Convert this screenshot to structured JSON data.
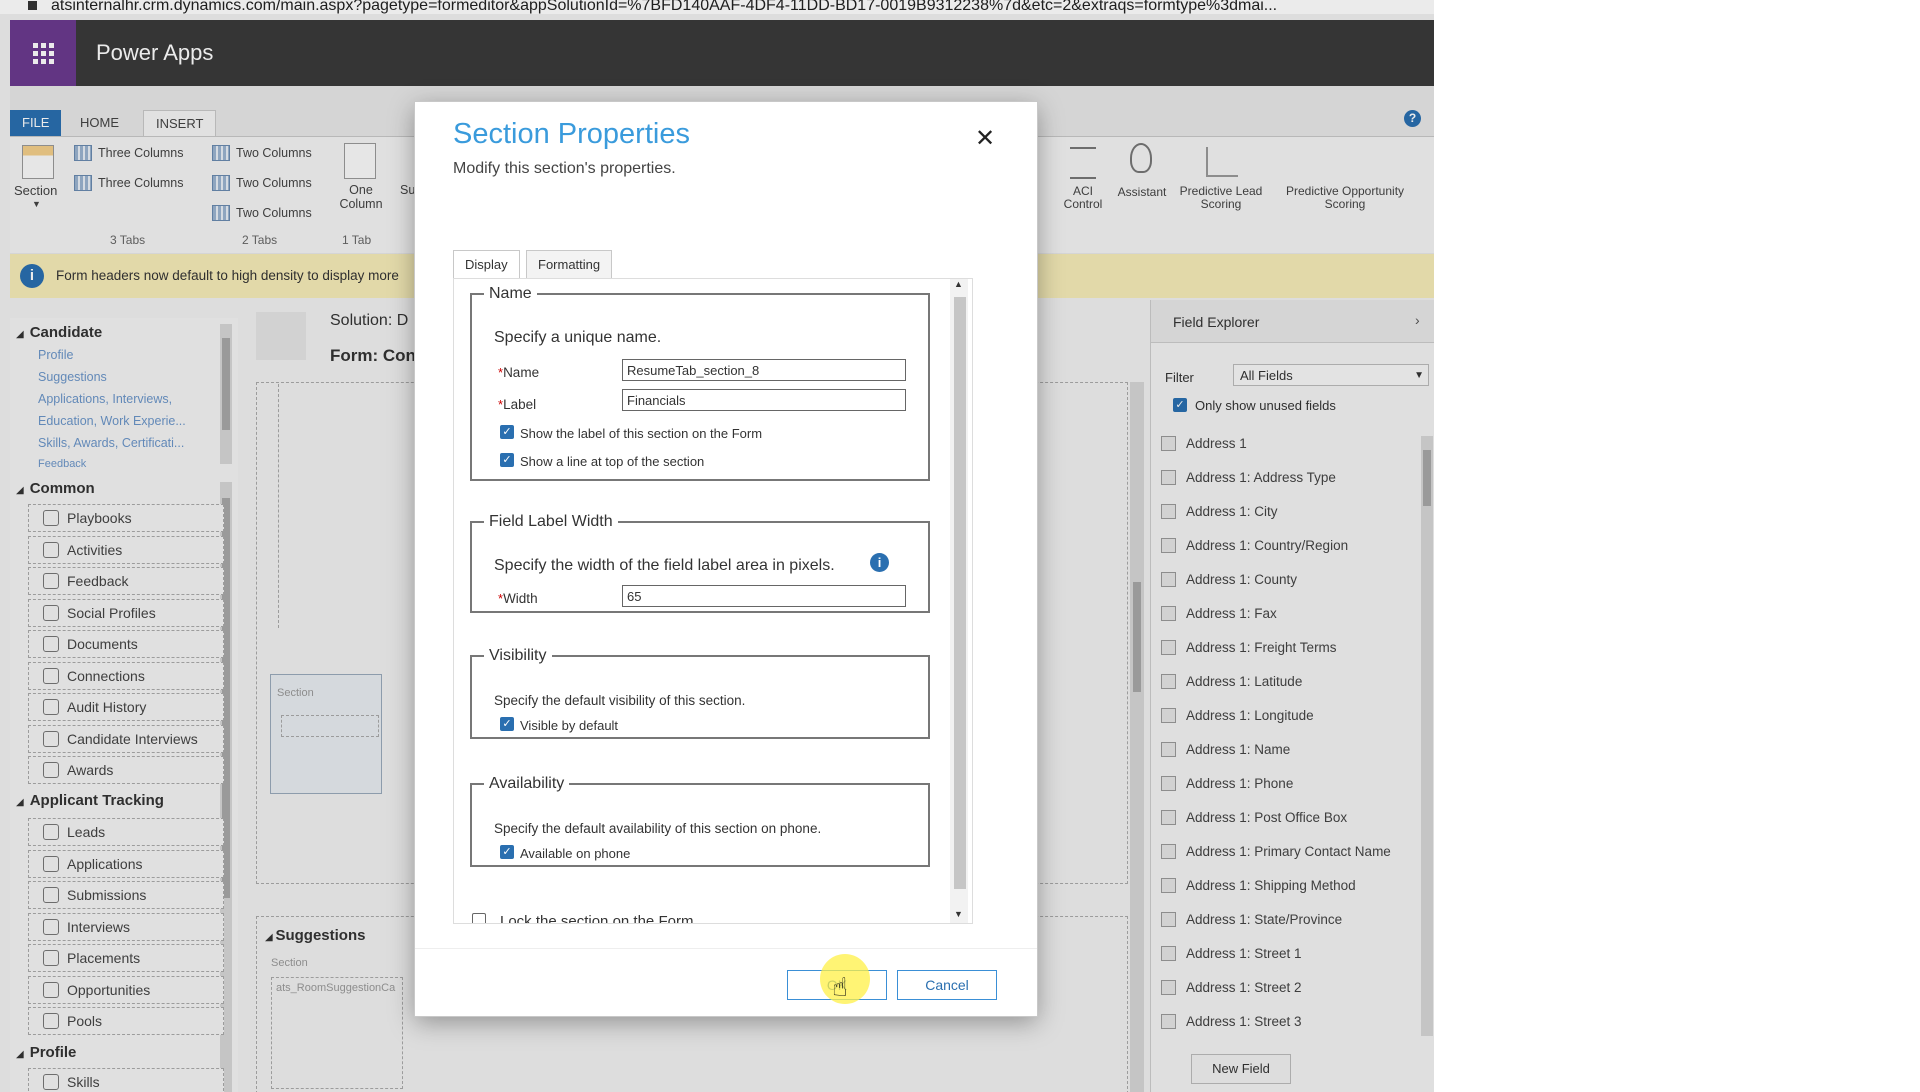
{
  "browser": {
    "url": "atsinternalhr.crm.dynamics.com/main.aspx?pagetype=formeditor&appSolutionId=%7BFD140AAF-4DF4-11DD-BD17-0019B9312238%7d&etc=2&extraqs=formtype%3dmai..."
  },
  "app": {
    "title": "Power Apps"
  },
  "ribbon": {
    "tabs": [
      "FILE",
      "HOME",
      "INSERT"
    ],
    "active_tab": "INSERT",
    "section_label": "Section",
    "three_tabs": [
      "Three Columns",
      "Three Columns"
    ],
    "three_tabs_group": "3 Tabs",
    "two_tabs": [
      "Two Columns",
      "Two Columns",
      "Two Columns"
    ],
    "two_tabs_group": "2 Tabs",
    "one_column": "One Column",
    "one_tab_group": "1 Tab",
    "partial_label": "Su",
    "aci_control": "ACI Control",
    "assistant": "Assistant",
    "predictive_lead": "Predictive Lead Scoring",
    "predictive_opp": "Predictive Opportunity Scoring"
  },
  "notification": {
    "text": "Form headers now default to high density to display more"
  },
  "leftnav": {
    "candidate_header": "Candidate",
    "candidate_items": [
      "Profile",
      "Suggestions",
      "Applications, Interviews,",
      "Education, Work Experie...",
      "Skills, Awards, Certificati...",
      "Feedback"
    ],
    "common_header": "Common",
    "common_items": [
      "Playbooks",
      "Activities",
      "Feedback",
      "Social Profiles",
      "Documents",
      "Connections",
      "Audit History",
      "Candidate Interviews",
      "Awards"
    ],
    "applicant_header": "Applicant Tracking",
    "applicant_items": [
      "Leads",
      "Applications",
      "Submissions",
      "Interviews",
      "Placements",
      "Opportunities",
      "Pools"
    ],
    "profile_header": "Profile",
    "profile_items": [
      "Skills"
    ]
  },
  "canvas": {
    "solution_label": "Solution: D",
    "form_label": "Form: Con",
    "section_placeholder": "Section",
    "suggestions_title": "Suggestions",
    "section_placeholder2": "Section",
    "subgrid_text": "ats_RoomSuggestionCa"
  },
  "field_explorer": {
    "title": "Field Explorer",
    "filter_label": "Filter",
    "filter_value": "All Fields",
    "only_unused": "Only show unused fields",
    "fields": [
      "Address 1",
      "Address 1: Address Type",
      "Address 1: City",
      "Address 1: Country/Region",
      "Address 1: County",
      "Address 1: Fax",
      "Address 1: Freight Terms",
      "Address 1: Latitude",
      "Address 1: Longitude",
      "Address 1: Name",
      "Address 1: Phone",
      "Address 1: Post Office Box",
      "Address 1: Primary Contact Name",
      "Address 1: Shipping Method",
      "Address 1: State/Province",
      "Address 1: Street 1",
      "Address 1: Street 2",
      "Address 1: Street 3"
    ],
    "new_field": "New Field"
  },
  "dialog": {
    "title": "Section Properties",
    "subtitle": "Modify this section's properties.",
    "tabs": [
      "Display",
      "Formatting"
    ],
    "name_group": {
      "legend": "Name",
      "desc": "Specify a unique name.",
      "name_label": "Name",
      "name_value": "ResumeTab_section_8",
      "label_label": "Label",
      "label_value": "Financials",
      "show_label": "Show the label of this section on the Form",
      "show_line": "Show a line at top of the section"
    },
    "width_group": {
      "legend": "Field Label Width",
      "desc": "Specify the width of the field label area in pixels.",
      "width_label": "Width",
      "width_value": "65"
    },
    "visibility_group": {
      "legend": "Visibility",
      "desc": "Specify the default visibility of this section.",
      "visible_label": "Visible by default"
    },
    "availability_group": {
      "legend": "Availability",
      "desc": "Specify the default availability of this section on phone.",
      "phone_label": "Available on phone"
    },
    "lock_label": "Lock the section on the Form",
    "ok_label": "OK",
    "cancel_label": "Cancel"
  },
  "colors": {
    "accent": "#2a6fb0",
    "title_blue": "#3a9bdc",
    "appbar": "#3a3a3a",
    "waffle": "#6b3a8f",
    "notification": "#f6ecb8"
  }
}
